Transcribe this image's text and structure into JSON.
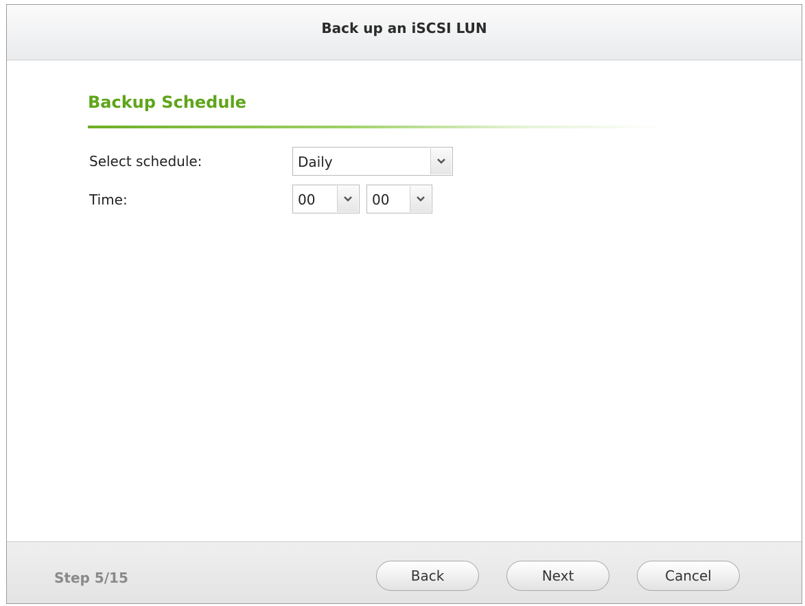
{
  "dialog": {
    "title": "Back up an iSCSI LUN"
  },
  "section": {
    "title": "Backup Schedule"
  },
  "form": {
    "schedule_label": "Select schedule:",
    "schedule_value": "Daily",
    "time_label": "Time:",
    "hour_value": "00",
    "minute_value": "00"
  },
  "footer": {
    "step_text": "Step 5/15",
    "back_label": "Back",
    "next_label": "Next",
    "cancel_label": "Cancel"
  },
  "icons": {
    "dropdown": "chevron-down-icon"
  },
  "colors": {
    "section_title": "#5ea51a",
    "accent_rule": "#6cae23"
  }
}
